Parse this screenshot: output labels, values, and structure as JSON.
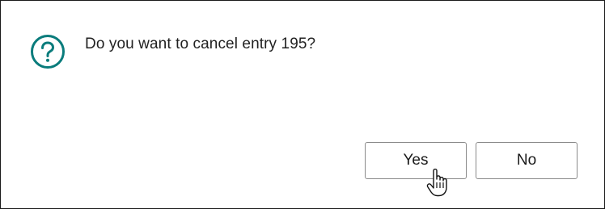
{
  "dialog": {
    "icon": "question-mark-circle-icon",
    "message": "Do you want to cancel entry 195?",
    "accent_color": "#0a7c7c",
    "buttons": {
      "yes_label": "Yes",
      "no_label": "No"
    }
  },
  "cursor": {
    "icon": "hand-pointer-cursor-icon"
  }
}
